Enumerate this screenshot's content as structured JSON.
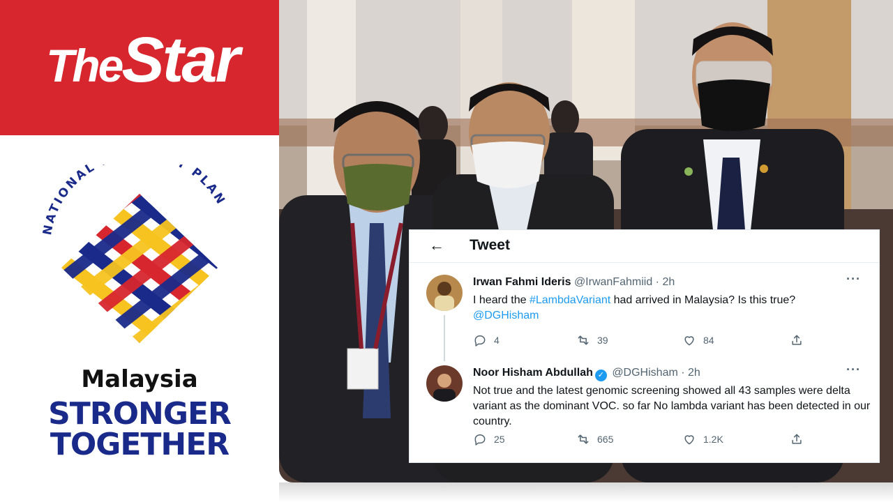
{
  "brand": {
    "logo_the": "The",
    "logo_star": "Star",
    "nrp_arc_text": "NATIONAL RECOVERY PLAN",
    "line_malaysia": "Malaysia",
    "line_stronger": "STRONGER",
    "line_together": "TOGETHER",
    "colors": {
      "red": "#d7262e",
      "navy": "#1a2a8a",
      "yellow": "#f7c320"
    }
  },
  "tweet": {
    "header_title": "Tweet",
    "tweets": [
      {
        "name": "Irwan Fahmi Ideris",
        "handle": "@IrwanFahmiid",
        "time": "2h",
        "text_pre": "I heard the ",
        "hashtag": "#LambdaVariant",
        "text_post": " had arrived in Malaysia? Is this true? ",
        "mention": "@DGHisham",
        "replies": "4",
        "retweets": "39",
        "likes": "84",
        "verified": false
      },
      {
        "name": "Noor Hisham Abdullah",
        "handle": "@DGHisham",
        "time": "2h",
        "text": "Not true and the latest genomic screening showed all 43 samples were delta variant as the dominant VOC. so far No lambda variant has been detected in our country.",
        "replies": "25",
        "retweets": "665",
        "likes": "1.2K",
        "verified": true
      }
    ]
  },
  "icons": [
    "back-arrow-icon",
    "more-icon",
    "reply-icon",
    "retweet-icon",
    "like-icon",
    "share-icon",
    "verified-icon"
  ]
}
